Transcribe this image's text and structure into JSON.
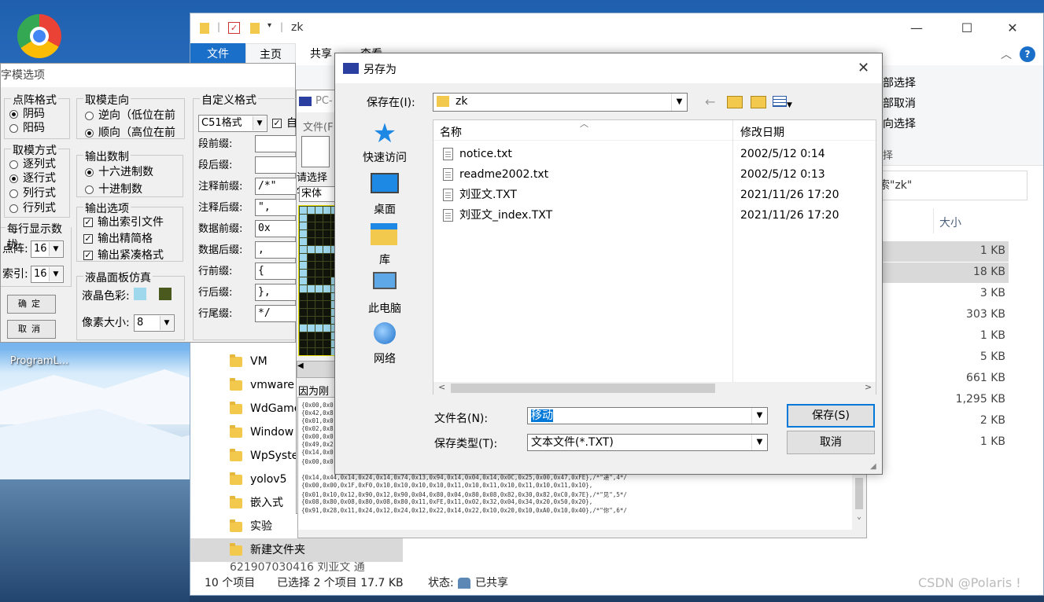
{
  "desktop": {
    "icons": [
      {
        "label": ""
      },
      {
        "label": "ProgramL..."
      }
    ]
  },
  "explorer": {
    "title": "zk",
    "tabs": [
      "文件",
      "主页",
      "共享",
      "查看"
    ],
    "ribbon_right": [
      "部选择",
      "部取消",
      "向选择",
      "择"
    ],
    "search_placeholder": "索\"zk\"",
    "size_header": "大小",
    "sizes": [
      "1 KB",
      "18 KB",
      "3 KB",
      "303 KB",
      "1 KB",
      "5 KB",
      "661 KB",
      "1,295 KB",
      "2 KB",
      "1 KB"
    ],
    "nav_items": [
      "VM",
      "vmware",
      "WdGame",
      "Window",
      "WpSyste",
      "yolov5",
      "嵌入式",
      "实验",
      "新建文件夹",
      "621907030416 刘亚文 通"
    ],
    "status": {
      "count": "10 个项目",
      "selected": "已选择 2 个项目  17.7 KB",
      "state": "状态: ",
      "shared": "已共享"
    },
    "watermark": "CSDN @Polaris !"
  },
  "zimo": {
    "title": "字模选项",
    "dot_format": {
      "title": "点阵格式",
      "options": [
        "阴码",
        "阳码"
      ],
      "selected": 0
    },
    "mode": {
      "title": "取模方式",
      "options": [
        "逐列式",
        "逐行式",
        "列行式",
        "行列式"
      ],
      "selected": 1
    },
    "per_line": {
      "title": "每行显示数拢",
      "dot_label": "点阵:",
      "dot_value": "16",
      "index_label": "索引:",
      "index_value": "16"
    },
    "direction": {
      "title": "取模走向",
      "options": [
        "逆向（低位在前",
        "顺向（高位在前"
      ],
      "selected": 1
    },
    "base": {
      "title": "输出数制",
      "options": [
        "十六进制数",
        "十进制数"
      ],
      "selected": 0
    },
    "output": {
      "title": "输出选项",
      "options": [
        "输出索引文件",
        "输出精简格",
        "输出紧凑格式"
      ]
    },
    "lcd": {
      "title": "液晶面板仿真",
      "color_label": "液晶色彩:",
      "pixel_label": "像素大小:",
      "pixel_value": "8",
      "color1": "#9fd8ec",
      "color2": "#4a5a1e"
    },
    "custom": {
      "title": "自定义格式",
      "format": "C51格式",
      "custom_chk": "自",
      "rows": [
        {
          "label": "段前缀:",
          "value": ""
        },
        {
          "label": "段后缀:",
          "value": ""
        },
        {
          "label": "注释前缀:",
          "value": "/*\""
        },
        {
          "label": "注释后缀:",
          "value": "\","
        },
        {
          "label": "数据前缀:",
          "value": "0x"
        },
        {
          "label": "数据后缀:",
          "value": ","
        },
        {
          "label": "行前缀:",
          "value": "{"
        },
        {
          "label": "行后缀:",
          "value": "},"
        },
        {
          "label": "行尾缀:",
          "value": "*/"
        }
      ]
    },
    "ok": "确定",
    "cancel": "取消"
  },
  "pc": {
    "title": "PC-",
    "menu": "文件(F",
    "choose": "请选择字",
    "font": "宋体",
    "notice": "因为刚"
  },
  "code_lines": [
    "{0x00,0x0",
    "{0x42,0x8",
    "{0x01,0x0",
    "{0x02,0x8",
    "{0x00,0x0",
    "{0x49,0x2",
    "{0x14,0x0",
    "{0x00,0x0",
    "{0x14,0x44,0x14,0x24,0x14,0x74,0x13,0x94,0x14,0x04,0x14,0x0C,0x25,0x00,0x47,0xFE},/*\"递\",4*/",
    "{0x00,0x00,0x1F,0xF0,0x10,0x10,0x10,0x10,0x11,0x10,0x11,0x10,0x11,0x10,0x11,0x10},",
    "{0x01,0x10,0x12,0x90,0x12,0x90,0x04,0x80,0x04,0x80,0x08,0x82,0x30,0x82,0xC0,0x7E},/*\"见\",5*/",
    "{0x08,0x80,0x08,0x80,0x08,0x80,0x11,0xFE,0x11,0x02,0x32,0x04,0x34,0x20,0x50,0x20},",
    "{0x91,0x28,0x11,0x24,0x12,0x24,0x12,0x22,0x14,0x22,0x10,0x20,0x10,0xA0,0x10,0x40},/*\"你\",6*/"
  ],
  "saveas": {
    "title": "另存为",
    "save_in_label": "保存在(I):",
    "save_in_value": "zk",
    "places": [
      "快速访问",
      "桌面",
      "库",
      "此电脑",
      "网络"
    ],
    "col_name": "名称",
    "col_date": "修改日期",
    "files": [
      {
        "name": "notice.txt",
        "date": "2002/5/12 0:14"
      },
      {
        "name": "readme2002.txt",
        "date": "2002/5/12 0:13"
      },
      {
        "name": "刘亚文.TXT",
        "date": "2021/11/26 17:20"
      },
      {
        "name": "刘亚文_index.TXT",
        "date": "2021/11/26 17:20"
      }
    ],
    "filename_label": "文件名(N):",
    "filename_value": "移动",
    "filetype_label": "保存类型(T):",
    "filetype_value": "文本文件(*.TXT)",
    "save_btn": "保存(S)",
    "cancel_btn": "取消"
  }
}
